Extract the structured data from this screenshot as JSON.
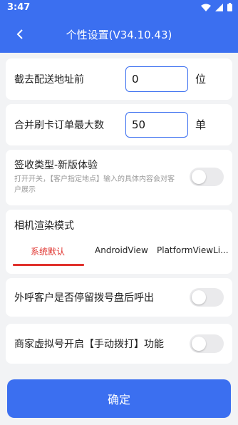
{
  "status_bar": {
    "time": "3:47"
  },
  "header": {
    "title": "个性设置(V34.10.43)"
  },
  "trim_address": {
    "label": "截去配送地址前",
    "value": "0",
    "unit": "位"
  },
  "merge_orders": {
    "label": "合并刷卡订单最大数",
    "value": "50",
    "unit": "单"
  },
  "sign_type": {
    "label": "签收类型-新版体验",
    "description": "打开开关，【客户指定地点】输入的具体内容会对客户展示"
  },
  "camera_mode": {
    "label": "相机渲染模式",
    "tabs": [
      "系统默认",
      "AndroidView",
      "PlatformViewLi..."
    ],
    "active_tab": 0
  },
  "call_stay": {
    "label": "外呼客户是否停留拨号盘后呼出"
  },
  "merchant_virtual": {
    "label": "商家虚拟号开启【手动拨打】功能"
  },
  "confirm_button": {
    "label": "确定"
  },
  "colors": {
    "primary": "#3b6ff0",
    "accent_red": "#e0312c"
  }
}
